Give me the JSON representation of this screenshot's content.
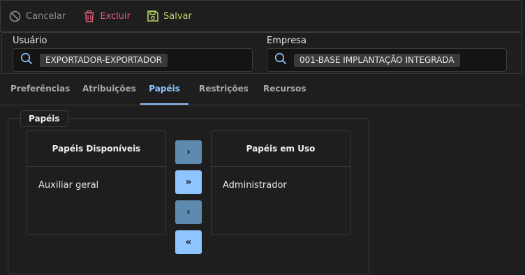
{
  "toolbar": {
    "cancel_label": "Cancelar",
    "delete_label": "Excluir",
    "save_label": "Salvar"
  },
  "filters": {
    "user": {
      "label": "Usuário",
      "chip": "EXPORTADOR-EXPORTADOR"
    },
    "company": {
      "label": "Empresa",
      "chip": "001-BASE IMPLANTAÇÃO INTEGRADA"
    }
  },
  "tabs": [
    {
      "label": "Preferências"
    },
    {
      "label": "Atribuições"
    },
    {
      "label": "Papéis",
      "active": true
    },
    {
      "label": "Restrições"
    },
    {
      "label": "Recursos"
    }
  ],
  "roles": {
    "legend": "Papéis",
    "available": {
      "title": "Papéis Disponíveis",
      "items": [
        "Auxiliar geral"
      ]
    },
    "in_use": {
      "title": "Papéis em Uso",
      "items": [
        "Administrador"
      ]
    },
    "buttons": {
      "move_one_right": "›",
      "move_all_right": "»",
      "move_one_left": "‹",
      "move_all_left": "«"
    }
  },
  "colors": {
    "accent": "#8ec5ff",
    "delete": "#e35d7a",
    "save": "#b9d36a",
    "muted": "#8a8f96"
  }
}
